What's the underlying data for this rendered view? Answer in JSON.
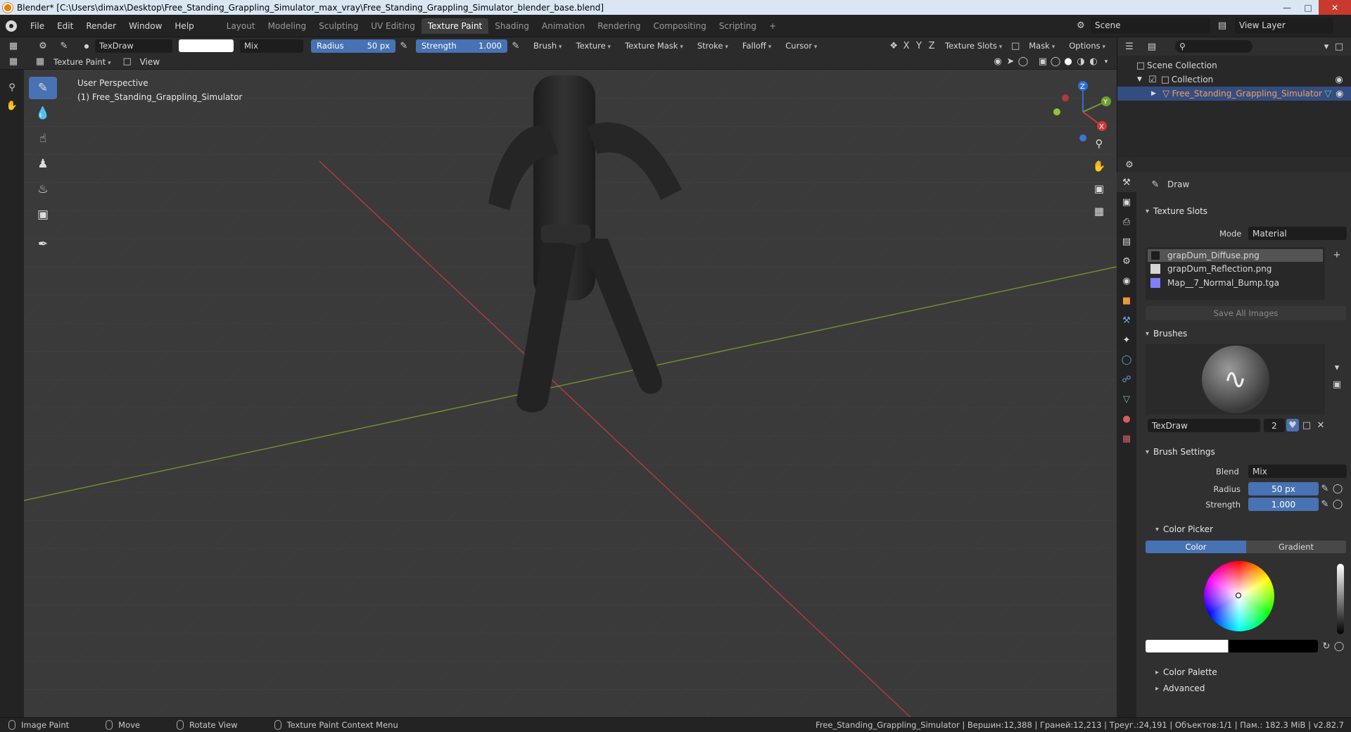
{
  "window": {
    "title": "Blender* [C:\\Users\\dimax\\Desktop\\Free_Standing_Grappling_Simulator_max_vray\\Free_Standing_Grappling_Simulator_blender_base.blend]"
  },
  "menu": [
    "File",
    "Edit",
    "Render",
    "Window",
    "Help"
  ],
  "workspaces": {
    "tabs": [
      "Layout",
      "Modeling",
      "Sculpting",
      "UV Editing",
      "Texture Paint",
      "Shading",
      "Animation",
      "Rendering",
      "Compositing",
      "Scripting"
    ],
    "active": "Texture Paint",
    "add": "+"
  },
  "scene": {
    "name": "Scene",
    "view_layer": "View Layer"
  },
  "tool_header": {
    "brush_name": "TexDraw",
    "blend": "Mix",
    "radius_label": "Radius",
    "radius_value": "50 px",
    "strength_label": "Strength",
    "strength_value": "1.000",
    "menus": [
      "Brush",
      "Texture",
      "Texture Mask",
      "Stroke",
      "Falloff",
      "Cursor"
    ],
    "axes": [
      "X",
      "Y",
      "Z"
    ],
    "texture_slots": "Texture Slots",
    "mask": "Mask",
    "options": "Options"
  },
  "mode_header": {
    "mode": "Texture Paint",
    "view": "View"
  },
  "viewport": {
    "perspective": "User Perspective",
    "object": "(1) Free_Standing_Grappling_Simulator",
    "gizmo": {
      "z": "Z",
      "y": "Y",
      "x": "X"
    },
    "colors": {
      "x_axis": "#b03a3a",
      "y_axis": "#6f8f2a",
      "bg": "#3a3a3a",
      "model": "#2a2a2a"
    }
  },
  "outliner": {
    "scene_collection": "Scene Collection",
    "collection": "Collection",
    "object": "Free_Standing_Grappling_Simulator"
  },
  "properties": {
    "tool_name": "Draw",
    "texture_slots": {
      "header": "Texture Slots",
      "mode_label": "Mode",
      "mode_value": "Material",
      "items": [
        {
          "name": "grapDum_Diffuse.png",
          "swatch": "#1d1d1d"
        },
        {
          "name": "grapDum_Reflection.png",
          "swatch": "#d6d6d6"
        },
        {
          "name": "Map__7_Normal_Bump.tga",
          "swatch": "#8080ff"
        }
      ],
      "save_all": "Save All Images"
    },
    "brushes": {
      "header": "Brushes",
      "name": "TexDraw",
      "users": "2"
    },
    "brush_settings": {
      "header": "Brush Settings",
      "blend_label": "Blend",
      "blend_value": "Mix",
      "radius_label": "Radius",
      "radius_value": "50 px",
      "strength_label": "Strength",
      "strength_value": "1.000"
    },
    "color_picker": {
      "header": "Color Picker",
      "tab_color": "Color",
      "tab_gradient": "Gradient"
    },
    "color_palette": "Color Palette",
    "advanced": "Advanced"
  },
  "statusbar": {
    "image_paint": "Image Paint",
    "move": "Move",
    "rotate": "Rotate View",
    "context": "Texture Paint Context Menu",
    "stats": "Free_Standing_Grappling_Simulator | Вершин:12,388 | Граней:12,213 | Треуг.:24,191 | Объектов:1/1 | Пам.: 182.3 MiB | v2.82.7"
  }
}
